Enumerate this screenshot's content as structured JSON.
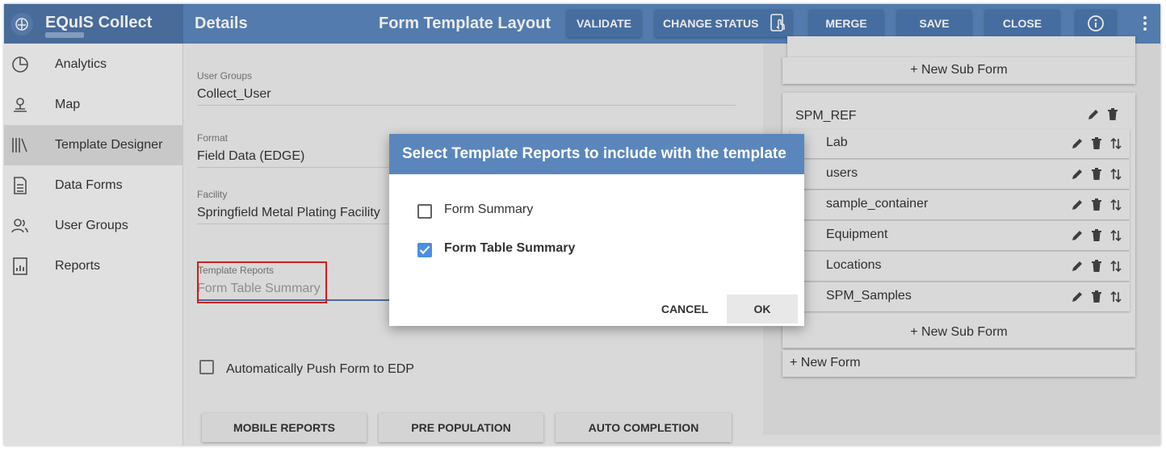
{
  "app": {
    "title": "EQuIS Collect"
  },
  "sidebar": {
    "items": [
      {
        "label": "Analytics",
        "icon": "pie-chart-icon"
      },
      {
        "label": "Map",
        "icon": "map-pin-icon"
      },
      {
        "label": "Template Designer",
        "icon": "library-icon",
        "active": true
      },
      {
        "label": "Data Forms",
        "icon": "document-icon"
      },
      {
        "label": "User Groups",
        "icon": "users-icon"
      },
      {
        "label": "Reports",
        "icon": "report-icon"
      }
    ]
  },
  "header": {
    "title": "Details",
    "center_title": "Form Template Layout",
    "buttons": {
      "validate": "VALIDATE",
      "change_status": "CHANGE STATUS",
      "merge": "MERGE",
      "save": "SAVE",
      "close": "CLOSE"
    }
  },
  "form": {
    "user_groups": {
      "label": "User Groups",
      "value": "Collect_User"
    },
    "format": {
      "label": "Format",
      "value": "Field Data (EDGE)"
    },
    "facility": {
      "label": "Facility",
      "value": "Springfield Metal Plating Facility"
    },
    "template_reports": {
      "label": "Template Reports",
      "value": "Form Table Summary"
    },
    "auto_push": {
      "label": "Automatically Push Form to EDP",
      "checked": false
    },
    "buttons": {
      "mobile_reports": "MOBILE REPORTS",
      "pre_population": "PRE POPULATION",
      "auto_completion": "AUTO COMPLETION"
    }
  },
  "right_panel": {
    "new_sub_form_top": "+ New Sub Form",
    "form_title": "SPM_REF",
    "sub_forms": [
      "Lab",
      "users",
      "sample_container",
      "Equipment",
      "Locations",
      "SPM_Samples"
    ],
    "new_sub_form": "+ New Sub Form",
    "new_form": "+ New Form"
  },
  "dialog": {
    "title": "Select Template Reports to include with the template",
    "options": [
      {
        "label": "Form Summary",
        "checked": false
      },
      {
        "label": "Form Table Summary",
        "checked": true
      }
    ],
    "cancel": "CANCEL",
    "ok": "OK"
  },
  "colors": {
    "header": "#5b86bc",
    "brand": "#4f75a8",
    "checkbox_on": "#4a8fe0",
    "highlight": "#e02020"
  }
}
